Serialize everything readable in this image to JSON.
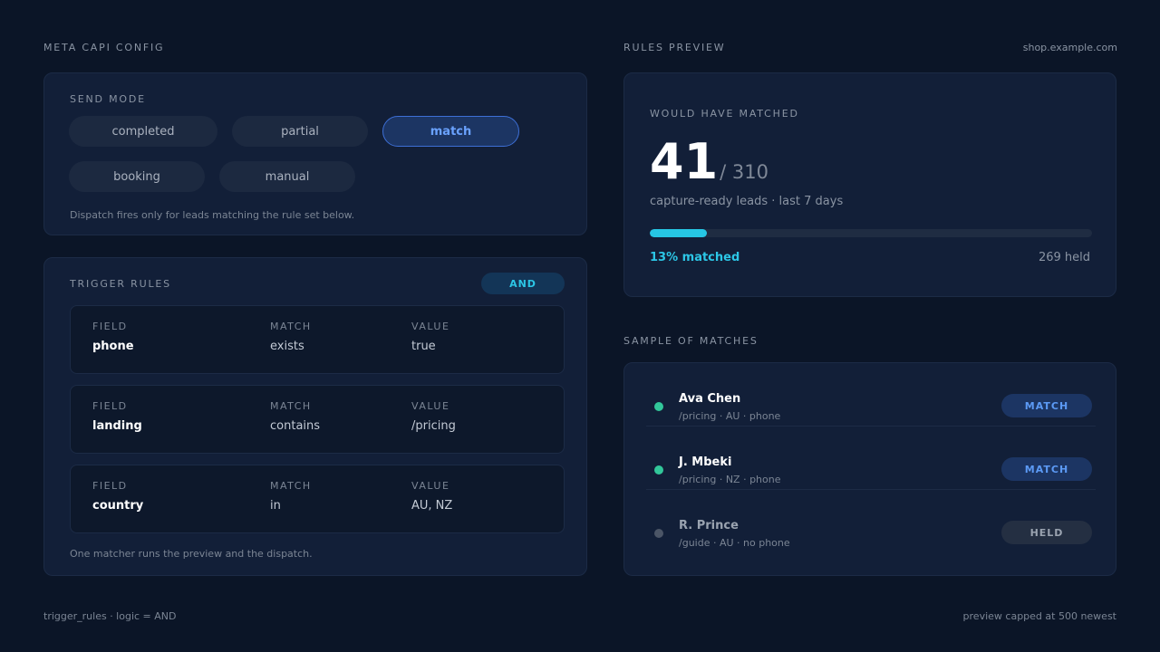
{
  "config": {
    "title": "META CAPI CONFIG",
    "send_mode": {
      "label": "SEND MODE",
      "options": [
        "completed",
        "partial",
        "match",
        "booking",
        "manual"
      ],
      "selected": "match",
      "hint": "Dispatch fires only for leads matching the rule set below."
    },
    "trigger_rules": {
      "label": "TRIGGER RULES",
      "logic": "AND",
      "col_field": "FIELD",
      "col_match": "MATCH",
      "col_value": "VALUE",
      "rules": [
        {
          "field": "phone",
          "match": "exists",
          "value": "true"
        },
        {
          "field": "landing",
          "match": "contains",
          "value": "/pricing"
        },
        {
          "field": "country",
          "match": "in",
          "value": "AU, NZ"
        }
      ],
      "note": "One matcher runs the preview and the dispatch."
    }
  },
  "preview": {
    "title": "RULES PREVIEW",
    "domain": "shop.example.com",
    "label": "WOULD HAVE MATCHED",
    "matched": "41",
    "total": "/ 310",
    "subtitle": "capture-ready leads · last 7 days",
    "match_fraction": 0.13,
    "pct_label": "13% matched",
    "held_label": "269 held"
  },
  "sample": {
    "title": "SAMPLE OF MATCHES",
    "items": [
      {
        "name": "Ava Chen",
        "meta": "/pricing · AU · phone",
        "status": "MATCH"
      },
      {
        "name": "J. Mbeki",
        "meta": "/pricing · NZ · phone",
        "status": "MATCH"
      },
      {
        "name": "R. Prince",
        "meta": "/guide · AU · no phone",
        "status": "HELD"
      }
    ]
  },
  "footer": {
    "left": "trigger_rules · logic = AND",
    "right": "preview capped at 500 newest"
  },
  "colors": {
    "accent": "#3d6fd6",
    "cyan": "#26c6e4",
    "match_green": "#32c79a"
  }
}
